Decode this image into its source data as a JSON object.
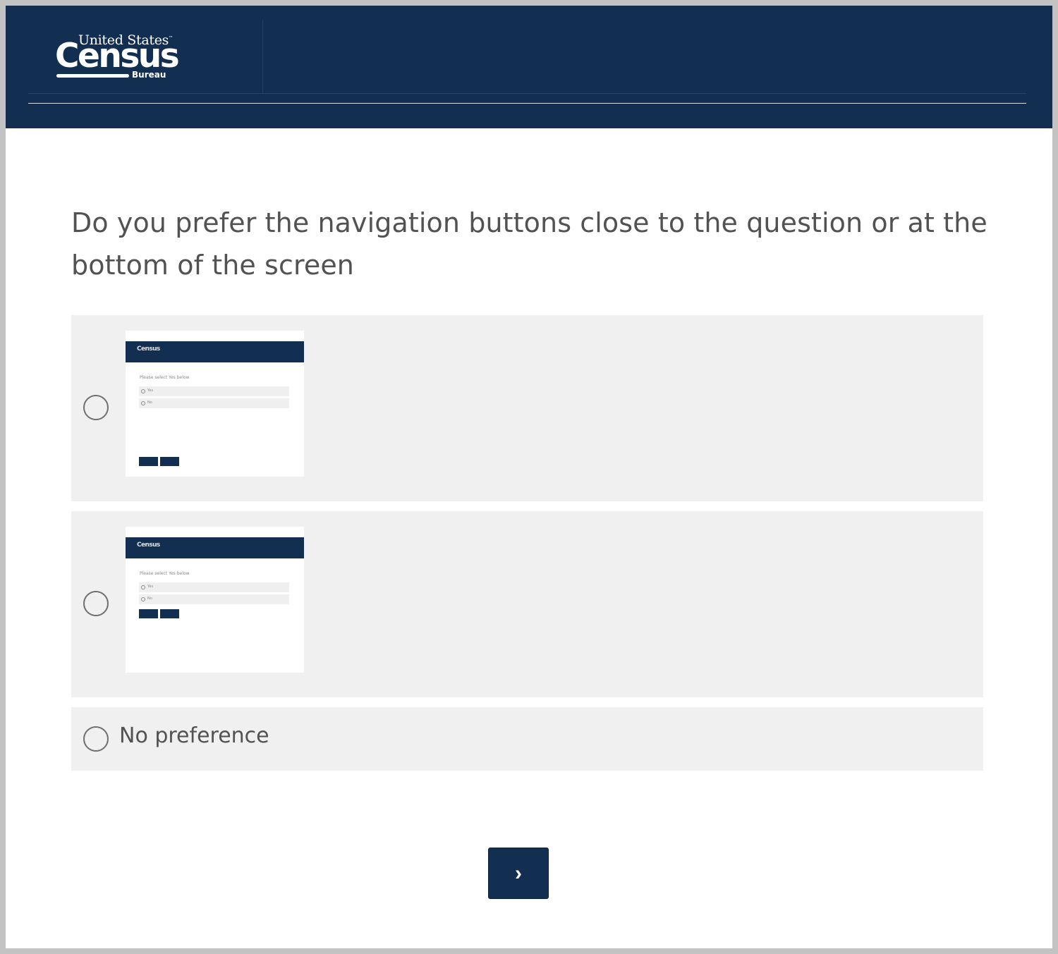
{
  "header": {
    "logo": {
      "line1": "United States",
      "trademark": "™",
      "line2": "Census",
      "line3": "Bureau"
    }
  },
  "question": {
    "text": "Do you prefer the navigation buttons close to the question or at the bottom of the screen"
  },
  "choices": [
    {
      "type": "image",
      "image": "layout-buttons-at-bottom-thumbnail",
      "selected": false,
      "thumb": {
        "logo": "Census",
        "question": "Please select Yes below",
        "options": [
          "Yes",
          "No"
        ]
      }
    },
    {
      "type": "image",
      "image": "layout-buttons-near-question-thumbnail",
      "selected": false,
      "thumb": {
        "logo": "Census",
        "question": "Please select Yes below",
        "options": [
          "Yes",
          "No"
        ]
      }
    },
    {
      "type": "text",
      "label": "No preference",
      "selected": false
    }
  ],
  "navigation": {
    "next_label": "›",
    "next_icon": "chevron-right-icon"
  },
  "colors": {
    "brand_navy": "#122e51",
    "choice_background": "#f0f0f0",
    "question_text": "#525252",
    "page_background": "#ffffff"
  }
}
